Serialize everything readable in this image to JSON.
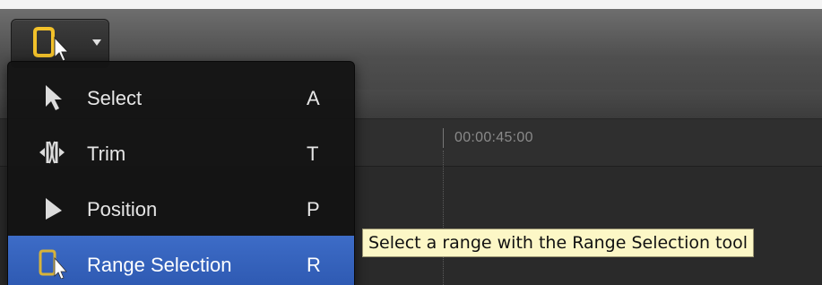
{
  "toolbar": {
    "tool_button": {
      "icon": "range-selection-icon",
      "dropdown": "chevron-down-icon",
      "accent": "#e7b31b"
    }
  },
  "timeline": {
    "timecode": "00:00:45:00"
  },
  "tool_menu": {
    "items": [
      {
        "label": "Select",
        "shortcut": "A",
        "icon": "arrow-cursor-icon",
        "selected": false
      },
      {
        "label": "Trim",
        "shortcut": "T",
        "icon": "trim-icon",
        "selected": false
      },
      {
        "label": "Position",
        "shortcut": "P",
        "icon": "position-arrow-icon",
        "selected": false
      },
      {
        "label": "Range Selection",
        "shortcut": "R",
        "icon": "range-selection-icon",
        "selected": true
      }
    ],
    "selection_color": "#3463bf"
  },
  "tooltip": {
    "text": "Select a range with the Range Selection tool"
  }
}
